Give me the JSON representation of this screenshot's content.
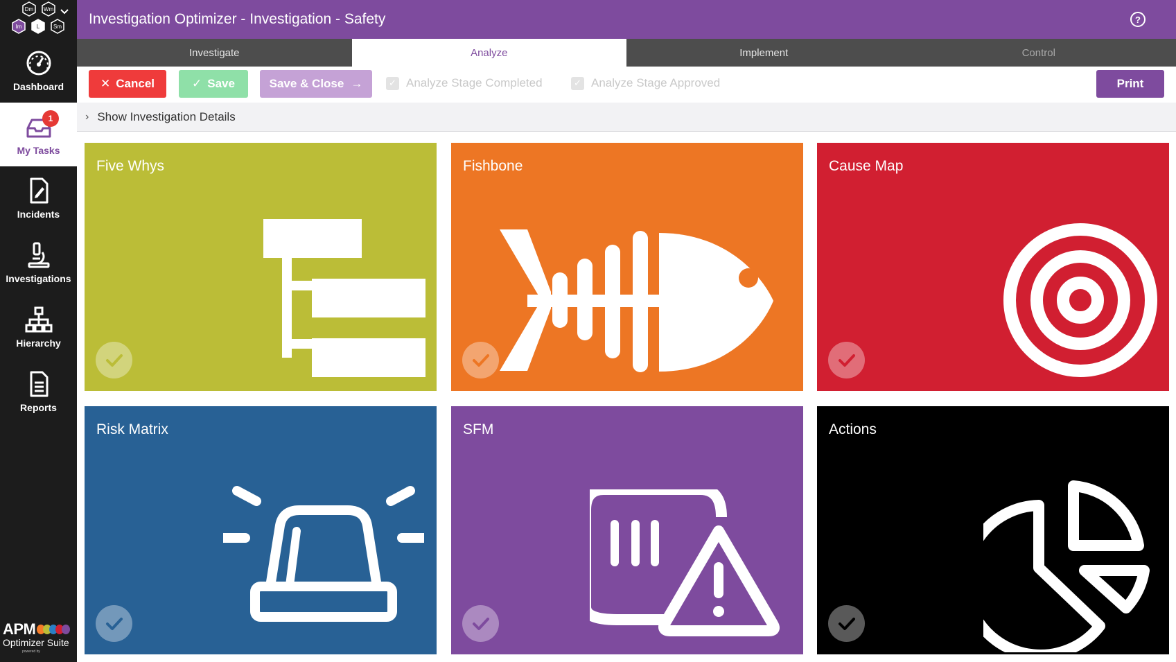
{
  "window": {
    "title": "Investigation Optimizer - Investigation - Safety"
  },
  "header": {
    "help_icon": "?"
  },
  "sidebar": {
    "logo_hexes": [
      "Dm",
      "Wm",
      "Im",
      "L",
      "Sm"
    ],
    "items": [
      {
        "label": "Dashboard",
        "icon": "dashboard-gauge-icon"
      },
      {
        "label": "My Tasks",
        "icon": "inbox-tray-icon",
        "badge": "1",
        "active": true
      },
      {
        "label": "Incidents",
        "icon": "document-edit-icon"
      },
      {
        "label": "Investigations",
        "icon": "microscope-icon"
      },
      {
        "label": "Hierarchy",
        "icon": "org-chart-icon"
      },
      {
        "label": "Reports",
        "icon": "report-document-icon"
      }
    ],
    "brand": {
      "name": "APM",
      "sub": "Optimizer Suite",
      "tiny": "powered by"
    }
  },
  "tabs": [
    {
      "label": "Investigate"
    },
    {
      "label": "Analyze",
      "active": true
    },
    {
      "label": "Implement"
    },
    {
      "label": "Control"
    }
  ],
  "toolbar": {
    "cancel_label": "Cancel",
    "save_label": "Save",
    "save_close_label": "Save & Close",
    "analyze_completed_label": "Analyze Stage Completed",
    "analyze_approved_label": "Analyze Stage Approved",
    "print_label": "Print"
  },
  "details": {
    "toggle_label": "Show Investigation Details"
  },
  "tiles": [
    {
      "title": "Five Whys",
      "color": "#bbbd37",
      "icon": "hierarchy-boxes-icon"
    },
    {
      "title": "Fishbone",
      "color": "#ed7624",
      "icon": "fish-skeleton-icon"
    },
    {
      "title": "Cause Map",
      "color": "#d11f31",
      "icon": "target-icon"
    },
    {
      "title": "Risk Matrix",
      "color": "#286195",
      "icon": "siren-alarm-icon"
    },
    {
      "title": "SFM",
      "color": "#7e4b9e",
      "icon": "report-warning-icon"
    },
    {
      "title": "Actions",
      "color": "#000000",
      "icon": "pie-chart-icon"
    }
  ],
  "colors": {
    "primary": "#7e4b9e",
    "sidebar": "#1c1c1c",
    "tab_bar": "#4d4d4d",
    "cancel": "#ef3b3b",
    "save": "#8fe0a8",
    "save_close": "#c5a2d6",
    "badge": "#e53935"
  }
}
